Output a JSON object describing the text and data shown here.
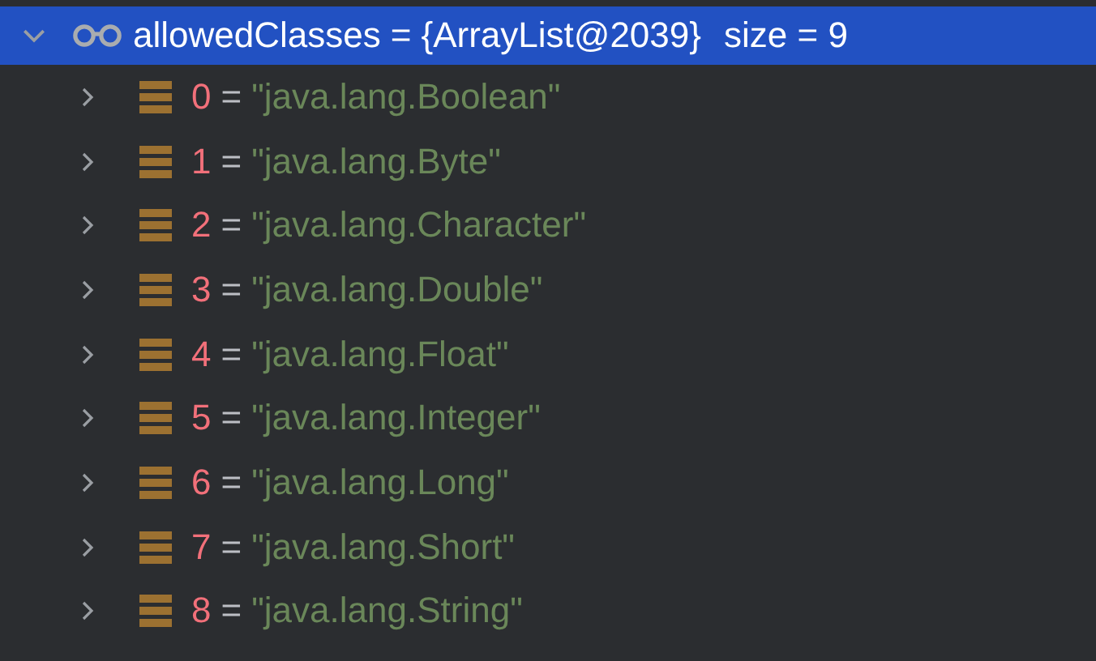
{
  "variable": {
    "name": "allowedClasses",
    "operator": "=",
    "value": "{ArrayList@2039}",
    "size_label": "size = 9",
    "expanded": true,
    "selected": true,
    "children": [
      {
        "index": "0",
        "operator": "=",
        "value": "\"java.lang.Boolean\"",
        "expanded": false
      },
      {
        "index": "1",
        "operator": "=",
        "value": "\"java.lang.Byte\"",
        "expanded": false
      },
      {
        "index": "2",
        "operator": "=",
        "value": "\"java.lang.Character\"",
        "expanded": false
      },
      {
        "index": "3",
        "operator": "=",
        "value": "\"java.lang.Double\"",
        "expanded": false
      },
      {
        "index": "4",
        "operator": "=",
        "value": "\"java.lang.Float\"",
        "expanded": false
      },
      {
        "index": "5",
        "operator": "=",
        "value": "\"java.lang.Integer\"",
        "expanded": false
      },
      {
        "index": "6",
        "operator": "=",
        "value": "\"java.lang.Long\"",
        "expanded": false
      },
      {
        "index": "7",
        "operator": "=",
        "value": "\"java.lang.Short\"",
        "expanded": false
      },
      {
        "index": "8",
        "operator": "=",
        "value": "\"java.lang.String\"",
        "expanded": false
      }
    ]
  }
}
